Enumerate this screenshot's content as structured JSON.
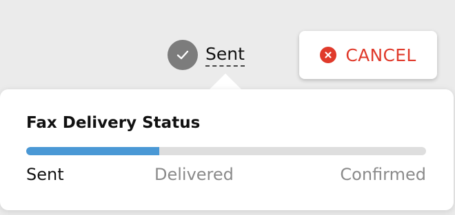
{
  "status": {
    "label": "Sent",
    "icon": "check-icon"
  },
  "cancel_button": {
    "label": "CANCEL",
    "icon": "close-circle-icon",
    "color": "#e03a2b"
  },
  "popover": {
    "title": "Fax Delivery Status",
    "progress_fraction": 0.333,
    "progress_color": "#4a98d5",
    "steps": [
      {
        "label": "Sent",
        "active": true
      },
      {
        "label": "Delivered",
        "active": false
      },
      {
        "label": "Confirmed",
        "active": false
      }
    ]
  }
}
